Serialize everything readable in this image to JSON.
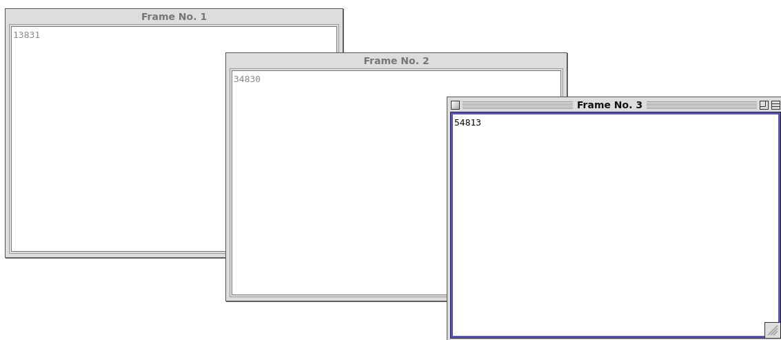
{
  "windows": [
    {
      "title": "Frame No. 1",
      "text": "13831",
      "active": false
    },
    {
      "title": "Frame No. 2",
      "text": "34830",
      "active": false
    },
    {
      "title": "Frame No. 3",
      "text": "54813",
      "active": true
    }
  ]
}
